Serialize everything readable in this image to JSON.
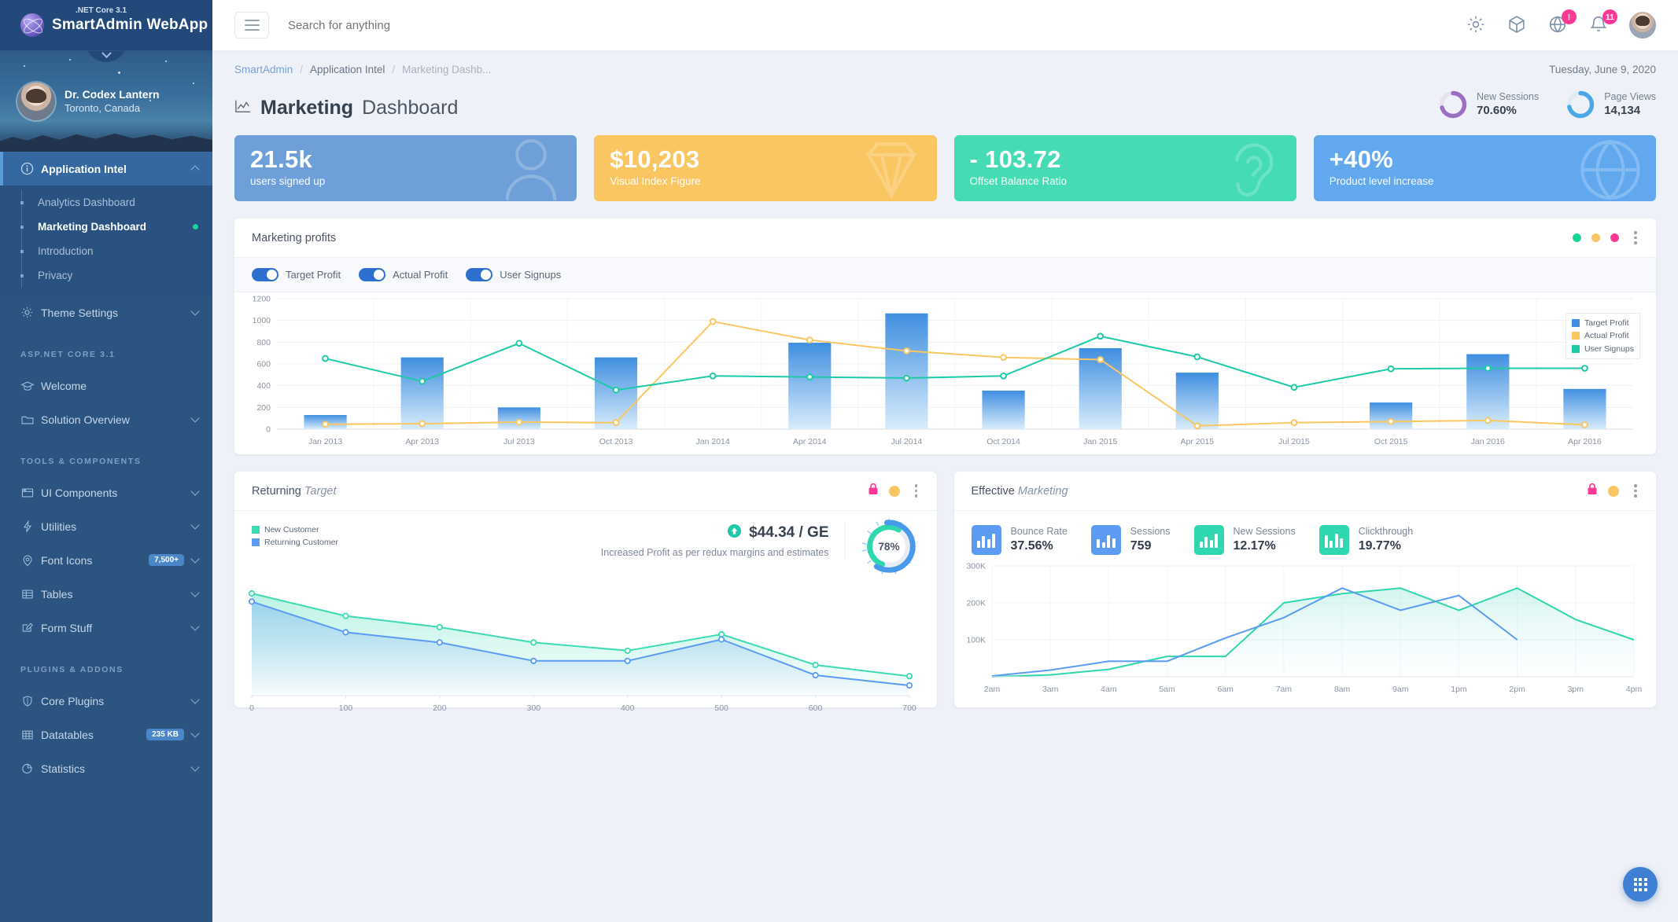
{
  "brand": {
    "name": "SmartAdmin WebApp",
    "framework": ".NET Core 3.1"
  },
  "user": {
    "name": "Dr. Codex Lantern",
    "location": "Toronto, Canada"
  },
  "search": {
    "placeholder": "Search for anything"
  },
  "header": {
    "globe_badge": "!",
    "bell_badge": "11"
  },
  "sidebar": {
    "active_group": "Application Intel",
    "groups": [
      {
        "label": "Application Intel",
        "icon": "info-icon",
        "expanded": true,
        "children": [
          {
            "label": "Analytics Dashboard",
            "active": false
          },
          {
            "label": "Marketing Dashboard",
            "active": true,
            "dot": true
          },
          {
            "label": "Introduction",
            "active": false
          },
          {
            "label": "Privacy",
            "active": false
          }
        ]
      },
      {
        "label": "Theme Settings",
        "icon": "gear-icon"
      }
    ],
    "section_aspnet": "ASP.NET CORE 3.1",
    "aspnet_items": [
      {
        "label": "Welcome",
        "icon": "graduation-cap-icon",
        "chevron": false
      },
      {
        "label": "Solution Overview",
        "icon": "folder-icon",
        "chevron": true
      }
    ],
    "section_tools": "TOOLS & COMPONENTS",
    "tools_items": [
      {
        "label": "UI Components",
        "icon": "window-icon",
        "chevron": true
      },
      {
        "label": "Utilities",
        "icon": "bolt-icon",
        "chevron": true
      },
      {
        "label": "Font Icons",
        "icon": "map-pin-icon",
        "badge": "7,500+",
        "chevron": true
      },
      {
        "label": "Tables",
        "icon": "table-icon",
        "chevron": true
      },
      {
        "label": "Form Stuff",
        "icon": "pencil-square-icon",
        "chevron": true
      }
    ],
    "section_plugins": "PLUGINS & ADDONS",
    "plugin_items": [
      {
        "label": "Core Plugins",
        "icon": "shield-icon",
        "chevron": true
      },
      {
        "label": "Datatables",
        "icon": "grid-table-icon",
        "badge": "235 KB",
        "chevron": true
      },
      {
        "label": "Statistics",
        "icon": "pie-chart-icon",
        "chevron": true
      }
    ]
  },
  "breadcrumb": {
    "l1": "SmartAdmin",
    "l2": "Application Intel",
    "l3": "Marketing Dashb...",
    "sep": "/"
  },
  "page": {
    "title_strong": "Marketing",
    "title_light": "Dashboard",
    "date": "Tuesday, June 9, 2020"
  },
  "mini_stats": [
    {
      "label": "New Sessions",
      "value": "70.60%",
      "color": "#9b6fc4",
      "pct": 70.6
    },
    {
      "label": "Page Views",
      "value": "14,134",
      "color": "#4aa8e8",
      "pct": 72
    }
  ],
  "kpis": [
    {
      "value": "21.5k",
      "label": "users signed up",
      "color": "#6f9fd8",
      "icon": "user-icon"
    },
    {
      "value": "$10,203",
      "label": "Visual Index Figure",
      "color": "#fac661",
      "icon": "diamond-icon"
    },
    {
      "value": "- 103.72",
      "label": "Offset Balance Ratio",
      "color": "#45dcb5",
      "icon": "ear-icon"
    },
    {
      "value": "+40%",
      "label": "Product level increase",
      "color": "#62a8ef",
      "icon": "globe-icon"
    }
  ],
  "marketing_card": {
    "title": "Marketing profits",
    "toggles": [
      {
        "label": "Target Profit",
        "on": true
      },
      {
        "label": "Actual Profit",
        "on": true
      },
      {
        "label": "User Signups",
        "on": true
      }
    ],
    "dots": [
      "#1ad598",
      "#fac661",
      "#fd3995"
    ]
  },
  "returning_card": {
    "title_strong": "Returning",
    "title_em": "Target",
    "legend": [
      {
        "label": "New Customer",
        "color": "#3ddab4"
      },
      {
        "label": "Returning Customer",
        "color": "#5b9bf3"
      }
    ],
    "profit_value": "$44.34 / GE",
    "profit_note": "Increased Profit as per redux margins and estimates",
    "gauge_value": "78%",
    "gauge_pct": 78,
    "lock_color": "#fd3995",
    "circle_color": "#fac661"
  },
  "effective_card": {
    "title_strong": "Effective",
    "title_em": "Marketing",
    "stats": [
      {
        "label": "Bounce Rate",
        "value": "37.56%",
        "color": "#5b9bf3",
        "icon": "bar-chart-icon"
      },
      {
        "label": "Sessions",
        "value": "759",
        "color": "#5b9bf3",
        "icon": "bar-chart-icon"
      },
      {
        "label": "New Sessions",
        "value": "12.17%",
        "color": "#2fd6ae",
        "icon": "bar-chart-icon"
      },
      {
        "label": "Clickthrough",
        "value": "19.77%",
        "color": "#2fd6ae",
        "icon": "bar-chart-icon"
      }
    ],
    "lock_color": "#fd3995",
    "circle_color": "#fac661"
  },
  "chart_data": [
    {
      "id": "marketing-profits",
      "type": "bar",
      "title": "Marketing profits",
      "categories": [
        "Jan 2013",
        "Apr 2013",
        "Jul 2013",
        "Oct 2013",
        "Jan 2014",
        "Apr 2014",
        "Jul 2014",
        "Oct 2014",
        "Jan 2015",
        "Apr 2015",
        "Jul 2015",
        "Oct 2015",
        "Jan 2016",
        "Apr 2016"
      ],
      "ylim": [
        0,
        1200
      ],
      "yticks": [
        0,
        200,
        400,
        600,
        800,
        1000,
        1200
      ],
      "grid": true,
      "legend_position": "top-right",
      "series": [
        {
          "name": "Target Profit",
          "type": "bar",
          "color": "#3f8fe0",
          "values": [
            130,
            660,
            200,
            660,
            0,
            795,
            1065,
            355,
            745,
            520,
            0,
            245,
            690,
            370
          ]
        },
        {
          "name": "Actual Profit",
          "type": "line",
          "color": "#fac661",
          "values": [
            45,
            50,
            65,
            60,
            990,
            820,
            720,
            660,
            640,
            30,
            60,
            70,
            80,
            40
          ]
        },
        {
          "name": "User Signups",
          "type": "line",
          "color": "#1ec9a8",
          "values": [
            650,
            440,
            790,
            360,
            490,
            480,
            470,
            490,
            855,
            665,
            385,
            555,
            560,
            560
          ]
        }
      ]
    },
    {
      "id": "returning-target",
      "type": "area",
      "x": [
        0,
        100,
        200,
        300,
        400,
        500,
        600,
        700
      ],
      "xlim": [
        0,
        700
      ],
      "xticks": [
        0,
        100,
        200,
        300,
        400,
        500,
        600,
        700
      ],
      "grid": false,
      "series": [
        {
          "name": "New Customer",
          "color": "#3ddab4",
          "values": [
            100,
            78,
            67,
            52,
            44,
            60,
            30,
            19
          ]
        },
        {
          "name": "Returning Customer",
          "color": "#5b9bf3",
          "values": [
            92,
            62,
            52,
            34,
            34,
            55,
            20,
            10
          ]
        }
      ]
    },
    {
      "id": "effective-marketing",
      "type": "line",
      "x": [
        "2am",
        "3am",
        "4am",
        "5am",
        "6am",
        "7am",
        "8am",
        "9am",
        "1pm",
        "2pm",
        "3pm",
        "4pm"
      ],
      "ylim": [
        0,
        300000
      ],
      "yticks": [
        100000,
        200000,
        300000
      ],
      "yticklabels": [
        "100K",
        "200K",
        "300K"
      ],
      "grid": true,
      "series": [
        {
          "name": "series-green",
          "color": "#2fd6ae",
          "values": [
            0,
            5000,
            20000,
            55000,
            55000,
            200000,
            225000,
            240000,
            180000,
            240000,
            155000,
            100000
          ]
        },
        {
          "name": "series-blue",
          "color": "#5b9bf3",
          "values": [
            2000,
            18000,
            42000,
            42000,
            105000,
            160000,
            240000,
            180000,
            220000,
            100000,
            null,
            null
          ]
        }
      ]
    }
  ]
}
